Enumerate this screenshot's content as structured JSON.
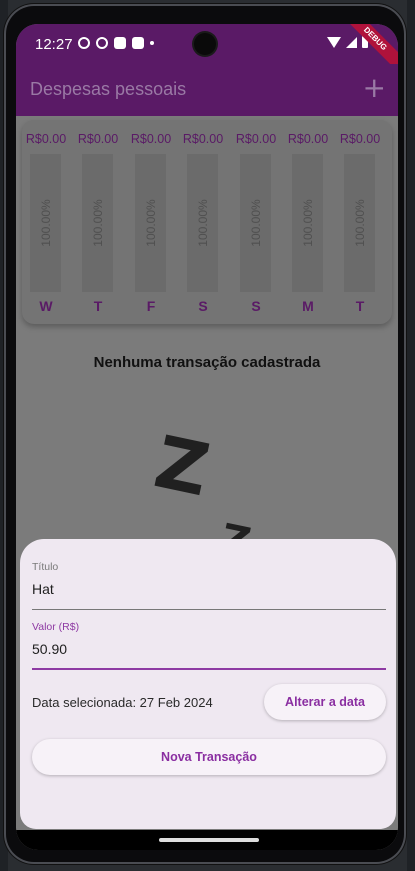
{
  "status": {
    "time": "12:27",
    "debug_label": "DEBUG"
  },
  "appbar": {
    "title": "Despesas pessoais",
    "add_icon": "+"
  },
  "chart": {
    "bars": [
      {
        "value": "R$0.00",
        "percent": "100.00%",
        "day": "W"
      },
      {
        "value": "R$0.00",
        "percent": "100.00%",
        "day": "T"
      },
      {
        "value": "R$0.00",
        "percent": "100.00%",
        "day": "F"
      },
      {
        "value": "R$0.00",
        "percent": "100.00%",
        "day": "S"
      },
      {
        "value": "R$0.00",
        "percent": "100.00%",
        "day": "S"
      },
      {
        "value": "R$0.00",
        "percent": "100.00%",
        "day": "M"
      },
      {
        "value": "R$0.00",
        "percent": "100.00%",
        "day": "T"
      }
    ]
  },
  "empty": {
    "message": "Nenhuma transação cadastrada",
    "z_big": "Z",
    "z_small": "Z"
  },
  "form": {
    "title_label": "Título",
    "title_value": "Hat",
    "value_label": "Valor (R$)",
    "value_value": "50.90",
    "date_text": "Data selecionada: 27 Feb 2024",
    "change_date_button": "Alterar a data",
    "submit_button": "Nova Transação"
  },
  "colors": {
    "primary": "#5a1a66",
    "accent": "#8e3aa3",
    "sheet_background": "#efe8f1"
  }
}
